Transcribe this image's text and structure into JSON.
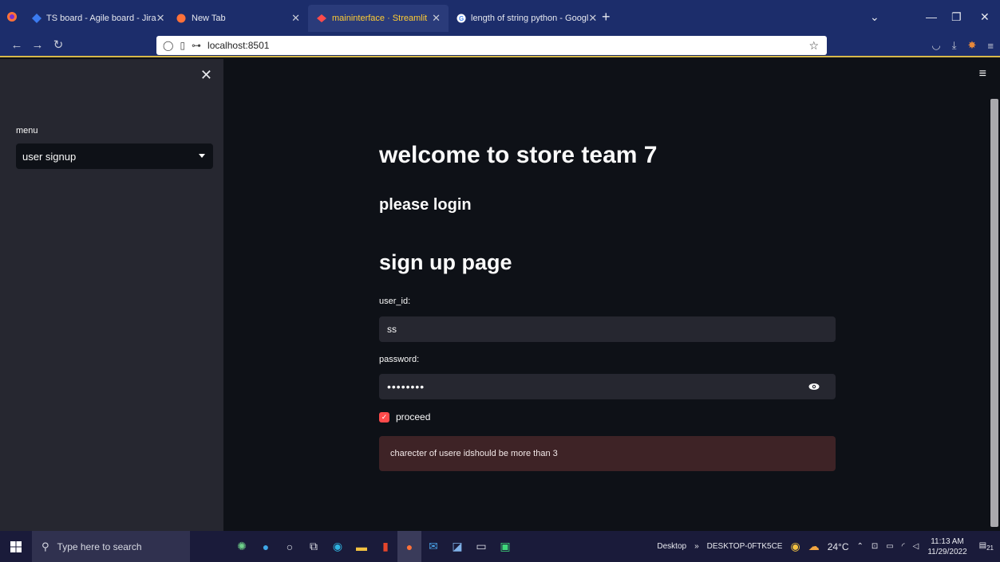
{
  "browser": {
    "tabs": [
      {
        "title": "TS board - Agile board - Jira",
        "active": false
      },
      {
        "title": "New Tab",
        "active": false
      },
      {
        "title": "maininterface · Streamlit",
        "active": true
      },
      {
        "title": "length of string python - Googl",
        "active": false
      }
    ],
    "url": "localhost:8501",
    "accent_color": "#ffcc33"
  },
  "sidebar": {
    "menu_label": "menu",
    "select_value": "user signup"
  },
  "main": {
    "title": "welcome to store team 7",
    "subtitle": "please login",
    "section_title": "sign up page",
    "user_id_label": "user_id:",
    "user_id_value": "ss",
    "password_label": "password:",
    "password_value": "••••••••",
    "checkbox_label": "proceed",
    "alert_text": "charecter of usere idshould be more than 3"
  },
  "taskbar": {
    "search_placeholder": "Type here to search",
    "desktop_label": "Desktop",
    "computer_name": "DESKTOP-0FTK5CE",
    "temperature": "24°C",
    "time": "11:13 AM",
    "date": "11/29/2022",
    "notifications": "21"
  }
}
